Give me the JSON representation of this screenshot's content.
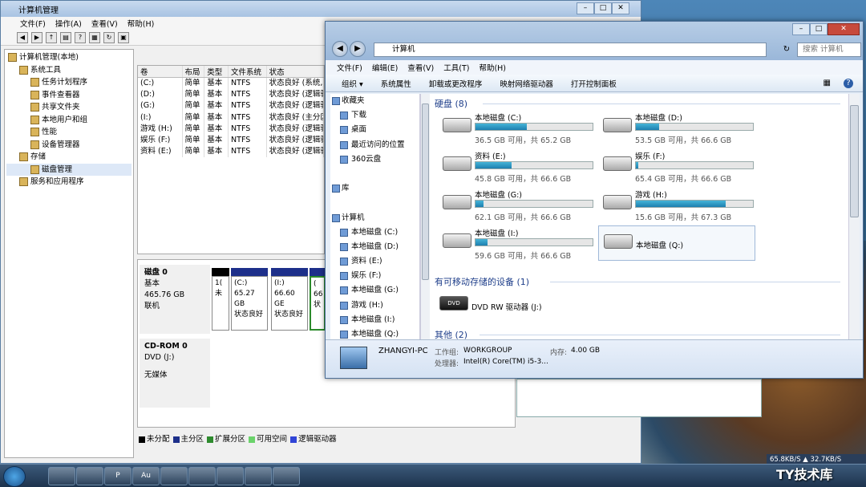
{
  "desktop": {
    "taskbar_apps": [
      "",
      "",
      "P",
      "Au",
      "",
      "",
      "",
      "",
      ""
    ],
    "network_speed": "65.8KB/S ▲ 32.7KB/S",
    "watermark": "TY技术库"
  },
  "mgmt": {
    "title": "计算机管理",
    "menu": [
      "文件(F)",
      "操作(A)",
      "查看(V)",
      "帮助(H)"
    ],
    "tree": [
      {
        "label": "计算机管理(本地)",
        "indent": 0
      },
      {
        "label": "系统工具",
        "indent": 1
      },
      {
        "label": "任务计划程序",
        "indent": 2
      },
      {
        "label": "事件查看器",
        "indent": 2
      },
      {
        "label": "共享文件夹",
        "indent": 2
      },
      {
        "label": "本地用户和组",
        "indent": 2
      },
      {
        "label": "性能",
        "indent": 2
      },
      {
        "label": "设备管理器",
        "indent": 2
      },
      {
        "label": "存储",
        "indent": 1
      },
      {
        "label": "磁盘管理",
        "indent": 2,
        "selected": true
      },
      {
        "label": "服务和应用程序",
        "indent": 1
      }
    ],
    "table_headers": [
      "卷",
      "布局",
      "类型",
      "文件系统",
      "状态"
    ],
    "table_rows": [
      [
        "(C:)",
        "简单",
        "基本",
        "NTFS",
        "状态良好 (系统,"
      ],
      [
        "(D:)",
        "简单",
        "基本",
        "NTFS",
        "状态良好 (逻辑驱"
      ],
      [
        "(G:)",
        "简单",
        "基本",
        "NTFS",
        "状态良好 (逻辑驱"
      ],
      [
        "(I:)",
        "简单",
        "基本",
        "NTFS",
        "状态良好 (主分区"
      ],
      [
        "游戏 (H:)",
        "简单",
        "基本",
        "NTFS",
        "状态良好 (逻辑驱"
      ],
      [
        "娱乐 (F:)",
        "简单",
        "基本",
        "NTFS",
        "状态良好 (逻辑驱"
      ],
      [
        "资料 (E:)",
        "简单",
        "基本",
        "NTFS",
        "状态良好 (逻辑驱"
      ]
    ],
    "disk0": {
      "name": "磁盘 0",
      "type": "基本",
      "size": "465.76 GB",
      "status": "联机"
    },
    "partitions": [
      {
        "l1": "",
        "l2": "1(",
        "l3": "未"
      },
      {
        "l1": "(C:)",
        "l2": "65.27 GB",
        "l3": "状态良好"
      },
      {
        "l1": "(I:)",
        "l2": "66.60 GE",
        "l3": "状态良好"
      },
      {
        "l1": "(",
        "l2": "66",
        "l3": "状"
      }
    ],
    "cdrom": {
      "name": "CD-ROM 0",
      "drive": "DVD (J:)",
      "media": "无媒体"
    },
    "legend": [
      "未分配",
      "主分区",
      "扩展分区",
      "可用空间",
      "逻辑驱动器"
    ]
  },
  "explorer": {
    "address": "计算机",
    "search_placeholder": "搜索 计算机",
    "menu": [
      "文件(F)",
      "编辑(E)",
      "查看(V)",
      "工具(T)",
      "帮助(H)"
    ],
    "commands": [
      "组织 ▾",
      "系统属性",
      "卸载或更改程序",
      "映射网络驱动器",
      "打开控制面板"
    ],
    "nav": [
      {
        "label": "收藏夹",
        "hdr": true
      },
      {
        "label": "下载"
      },
      {
        "label": "桌面"
      },
      {
        "label": "最近访问的位置"
      },
      {
        "label": "360云盘"
      },
      {
        "label": ""
      },
      {
        "label": "库",
        "hdr": true
      },
      {
        "label": ""
      },
      {
        "label": "计算机",
        "hdr": true
      },
      {
        "label": "本地磁盘 (C:)"
      },
      {
        "label": "本地磁盘 (D:)"
      },
      {
        "label": "资料 (E:)"
      },
      {
        "label": "娱乐 (F:)"
      },
      {
        "label": "本地磁盘 (G:)"
      },
      {
        "label": "游戏 (H:)"
      },
      {
        "label": "本地磁盘 (I:)"
      },
      {
        "label": "本地磁盘 (Q:)"
      }
    ],
    "group_hdd": "硬盘 (8)",
    "group_removable": "有可移动存储的设备 (1)",
    "group_other": "其他 (2)",
    "drives": [
      {
        "name": "本地磁盘 (C:)",
        "size": "36.5 GB 可用，共 65.2 GB",
        "used": 0.44
      },
      {
        "name": "本地磁盘 (D:)",
        "size": "53.5 GB 可用，共 66.6 GB",
        "used": 0.2
      },
      {
        "name": "资料 (E:)",
        "size": "45.8 GB 可用，共 66.6 GB",
        "used": 0.31
      },
      {
        "name": "娱乐 (F:)",
        "size": "65.4 GB 可用，共 66.6 GB",
        "used": 0.02
      },
      {
        "name": "本地磁盘 (G:)",
        "size": "62.1 GB 可用，共 66.6 GB",
        "used": 0.07
      },
      {
        "name": "游戏 (H:)",
        "size": "15.6 GB 可用，共 67.3 GB",
        "used": 0.77
      },
      {
        "name": "本地磁盘 (I:)",
        "size": "59.6 GB 可用，共 66.6 GB",
        "used": 0.1
      },
      {
        "name": "本地磁盘 (Q:)",
        "size": "",
        "used": null
      }
    ],
    "dvd": "DVD RW 驱动器 (J:)",
    "status": {
      "pc": "ZHANGYI-PC",
      "workgroup_label": "工作组:",
      "workgroup": "WORKGROUP",
      "memory_label": "内存:",
      "memory": "4.00 GB",
      "cpu_label": "处理器:",
      "cpu": "Intel(R) Core(TM) i5-3..."
    }
  }
}
